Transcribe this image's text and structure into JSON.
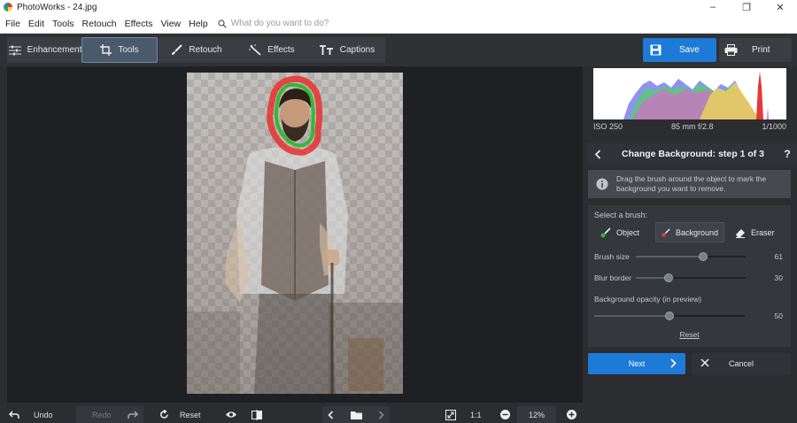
{
  "window": {
    "title": "PhotoWorks - 24.jpg",
    "minimize": "–",
    "maximize": "❐",
    "close": "✕"
  },
  "menu": {
    "items": [
      "File",
      "Edit",
      "Tools",
      "Retouch",
      "Effects",
      "View",
      "Help"
    ],
    "search_placeholder": "What do you want to do?"
  },
  "toolbar": {
    "tabs": [
      "Enhancement",
      "Tools",
      "Retouch",
      "Effects",
      "Captions"
    ],
    "active_tab": "Tools",
    "save_label": "Save",
    "print_label": "Print"
  },
  "histogram": {
    "iso": "ISO 250",
    "lens": "85 mm f/2.8",
    "shutter": "1/1000"
  },
  "panel": {
    "step_title": "Change Background: step 1 of 3",
    "help": "?",
    "info_line1": "Drag the brush around the object to mark the",
    "info_line2": "background you want to remove.",
    "select_brush_label": "Select a brush:",
    "brushes": [
      "Object",
      "Background",
      "Eraser"
    ],
    "active_brush": "Background",
    "brush_size_label": "Brush size",
    "brush_size_value": "61",
    "blur_border_label": "Blur border",
    "blur_border_value": "30",
    "opacity_label": "Background opacity (in preview)",
    "opacity_value": "50",
    "reset_label": "Reset",
    "next_label": "Next",
    "cancel_label": "Cancel"
  },
  "sliders": {
    "brush_size_fraction": 0.61,
    "blur_border_fraction": 0.3,
    "opacity_fraction": 0.5
  },
  "bottom": {
    "undo_label": "Undo",
    "redo_label": "Redo",
    "reset_label": "Reset",
    "one_to_one": "1:1",
    "zoom_value": "12%"
  },
  "colors": {
    "accent": "#1d7ad6",
    "object_mark": "#2eb82e",
    "background_mark": "#e53935"
  }
}
